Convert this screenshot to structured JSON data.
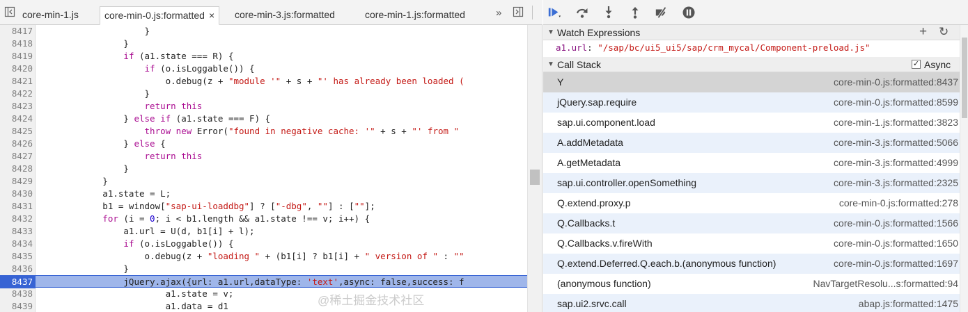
{
  "editor": {
    "tabs": [
      {
        "label": "core-min-1.js",
        "active": false
      },
      {
        "label": "core-min-0.js:formatted",
        "active": true,
        "close": "×"
      },
      {
        "label": "core-min-3.js:formatted",
        "active": false
      },
      {
        "label": "core-min-1.js:formatted",
        "active": false
      }
    ],
    "overflow_glyph": "»",
    "execution_line": 8437,
    "lines": [
      {
        "n": "8417",
        "tokens": [
          [
            "p",
            "                    }"
          ]
        ]
      },
      {
        "n": "8418",
        "tokens": [
          [
            "p",
            "                }"
          ]
        ]
      },
      {
        "n": "8419",
        "tokens": [
          [
            "p",
            "                "
          ],
          [
            "kw",
            "if"
          ],
          [
            "p",
            " (a1.state === R) {"
          ]
        ]
      },
      {
        "n": "8420",
        "tokens": [
          [
            "p",
            "                    "
          ],
          [
            "kw",
            "if"
          ],
          [
            "p",
            " (o.isLoggable()) {"
          ]
        ]
      },
      {
        "n": "8421",
        "tokens": [
          [
            "p",
            "                        o.debug(z + "
          ],
          [
            "str",
            "\"module '\""
          ],
          [
            "p",
            " + s + "
          ],
          [
            "str",
            "\"' has already been loaded ("
          ]
        ]
      },
      {
        "n": "8422",
        "tokens": [
          [
            "p",
            "                    }"
          ]
        ]
      },
      {
        "n": "8423",
        "tokens": [
          [
            "p",
            "                    "
          ],
          [
            "kw",
            "return this"
          ]
        ]
      },
      {
        "n": "8424",
        "tokens": [
          [
            "p",
            "                } "
          ],
          [
            "kw",
            "else if"
          ],
          [
            "p",
            " (a1.state === F) {"
          ]
        ]
      },
      {
        "n": "8425",
        "tokens": [
          [
            "p",
            "                    "
          ],
          [
            "kw",
            "throw new"
          ],
          [
            "p",
            " Error("
          ],
          [
            "str",
            "\"found in negative cache: '\""
          ],
          [
            "p",
            " + s + "
          ],
          [
            "str",
            "\"' from \""
          ]
        ]
      },
      {
        "n": "8426",
        "tokens": [
          [
            "p",
            "                } "
          ],
          [
            "kw",
            "else"
          ],
          [
            "p",
            " {"
          ]
        ]
      },
      {
        "n": "8427",
        "tokens": [
          [
            "p",
            "                    "
          ],
          [
            "kw",
            "return this"
          ]
        ]
      },
      {
        "n": "8428",
        "tokens": [
          [
            "p",
            "                }"
          ]
        ]
      },
      {
        "n": "8429",
        "tokens": [
          [
            "p",
            "            }"
          ]
        ]
      },
      {
        "n": "8430",
        "tokens": [
          [
            "p",
            "            a1.state = L;"
          ]
        ]
      },
      {
        "n": "8431",
        "tokens": [
          [
            "p",
            "            b1 = window["
          ],
          [
            "str",
            "\"sap-ui-loaddbg\""
          ],
          [
            "p",
            "] ? ["
          ],
          [
            "str",
            "\"-dbg\""
          ],
          [
            "p",
            ", "
          ],
          [
            "str",
            "\"\""
          ],
          [
            "p",
            "] : ["
          ],
          [
            "str",
            "\"\""
          ],
          [
            "p",
            "];"
          ]
        ]
      },
      {
        "n": "8432",
        "tokens": [
          [
            "kw",
            "            for"
          ],
          [
            "p",
            " (i = "
          ],
          [
            "num",
            "0"
          ],
          [
            "p",
            "; i < b1.length && a1.state !== v; i++) {"
          ]
        ]
      },
      {
        "n": "8433",
        "tokens": [
          [
            "p",
            "                a1.url = U(d, b1[i] + l);"
          ]
        ]
      },
      {
        "n": "8434",
        "tokens": [
          [
            "p",
            "                "
          ],
          [
            "kw",
            "if"
          ],
          [
            "p",
            " (o.isLoggable()) {"
          ]
        ]
      },
      {
        "n": "8435",
        "tokens": [
          [
            "p",
            "                    o.debug(z + "
          ],
          [
            "str",
            "\"loading \""
          ],
          [
            "p",
            " + (b1[i] ? b1[i] + "
          ],
          [
            "str",
            "\" version of \""
          ],
          [
            "p",
            " : "
          ],
          [
            "str",
            "\"\""
          ]
        ]
      },
      {
        "n": "8436",
        "tokens": [
          [
            "p",
            "                }"
          ]
        ]
      },
      {
        "n": "8437",
        "tokens": [
          [
            "p",
            "                jQuery.ajax({url: a1.url,dataType: "
          ],
          [
            "str",
            "'text'"
          ],
          [
            "p",
            ",async: false,success: f"
          ]
        ]
      },
      {
        "n": "8438",
        "tokens": [
          [
            "p",
            "                        a1.state = v;"
          ]
        ]
      },
      {
        "n": "8439",
        "tokens": [
          [
            "p",
            "                        a1.data = d1"
          ]
        ]
      }
    ]
  },
  "sidebar": {
    "toolbar_icons": [
      "resume-icon",
      "step-over-icon",
      "step-into-icon",
      "step-out-icon",
      "deactivate-breakpoints-icon",
      "pause-on-exceptions-icon"
    ],
    "watch": {
      "title": "Watch Expressions",
      "add_glyph": "+",
      "refresh_glyph": "↻",
      "expr_name": "a1.url",
      "expr_sep": ": ",
      "expr_value": "\"/sap/bc/ui5_ui5/sap/crm_mycal/Component-preload.js\""
    },
    "callstack": {
      "title": "Call Stack",
      "async_label": "Async",
      "async_checked": true,
      "frames": [
        {
          "fn": "Y",
          "loc": "core-min-0.js:formatted:8437",
          "selected": true
        },
        {
          "fn": "jQuery.sap.require",
          "loc": "core-min-0.js:formatted:8599"
        },
        {
          "fn": "sap.ui.component.load",
          "loc": "core-min-1.js:formatted:3823"
        },
        {
          "fn": "A.addMetadata",
          "loc": "core-min-3.js:formatted:5066"
        },
        {
          "fn": "A.getMetadata",
          "loc": "core-min-3.js:formatted:4999"
        },
        {
          "fn": "sap.ui.controller.openSomething",
          "loc": "core-min-3.js:formatted:2325"
        },
        {
          "fn": "Q.extend.proxy.p",
          "loc": "core-min-0.js:formatted:278"
        },
        {
          "fn": "Q.Callbacks.t",
          "loc": "core-min-0.js:formatted:1566"
        },
        {
          "fn": "Q.Callbacks.v.fireWith",
          "loc": "core-min-0.js:formatted:1650"
        },
        {
          "fn": "Q.extend.Deferred.Q.each.b.(anonymous function)",
          "loc": "core-min-0.js:formatted:1697"
        },
        {
          "fn": "(anonymous function)",
          "loc": "NavTargetResolu...s:formatted:94"
        },
        {
          "fn": "sap.ui2.srvc.call",
          "loc": "abap.js:formatted:1475"
        }
      ]
    }
  },
  "watermark": "@稀土掘金技术社区"
}
